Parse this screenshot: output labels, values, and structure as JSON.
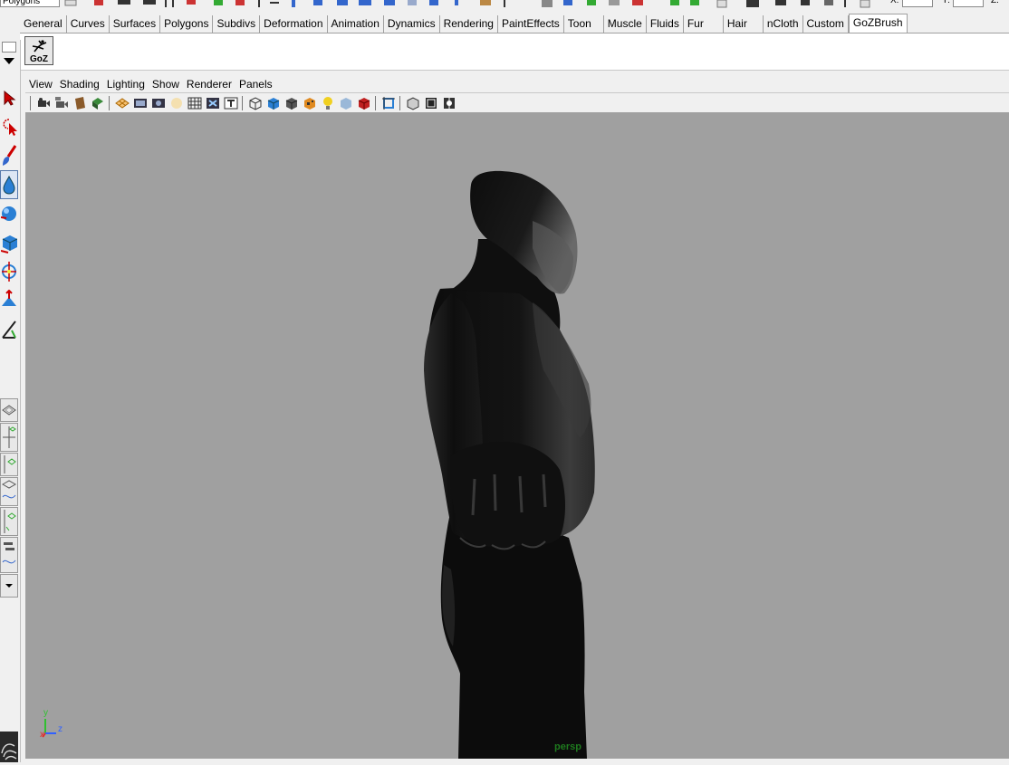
{
  "top_strip": {
    "mode_value": "Polygons",
    "field_labels": [
      "X:",
      "Y:",
      "Z:"
    ]
  },
  "shelf": {
    "tabs": [
      {
        "label": "General"
      },
      {
        "label": "Curves"
      },
      {
        "label": "Surfaces"
      },
      {
        "label": "Polygons"
      },
      {
        "label": "Subdivs"
      },
      {
        "label": "Deformation"
      },
      {
        "label": "Animation"
      },
      {
        "label": "Dynamics"
      },
      {
        "label": "Rendering"
      },
      {
        "label": "PaintEffects"
      },
      {
        "label": "Toon"
      },
      {
        "label": "Muscle"
      },
      {
        "label": "Fluids"
      },
      {
        "label": "Fur"
      },
      {
        "label": "Hair"
      },
      {
        "label": "nCloth"
      },
      {
        "label": "Custom"
      },
      {
        "label": "GoZBrush"
      }
    ],
    "active_tab": "GoZBrush",
    "goz_button_label": "GoZ"
  },
  "panel": {
    "menus": [
      "View",
      "Shading",
      "Lighting",
      "Show",
      "Renderer",
      "Panels"
    ]
  },
  "viewport": {
    "camera_label": "persp",
    "background_color": "#a0a0a0",
    "axis_labels": {
      "y": "y",
      "z": "z",
      "x": "x"
    }
  },
  "colors": {
    "axis_x": "#e03030",
    "axis_y": "#30c030",
    "axis_z": "#3060ff",
    "camera_label": "#1e7a1e"
  }
}
